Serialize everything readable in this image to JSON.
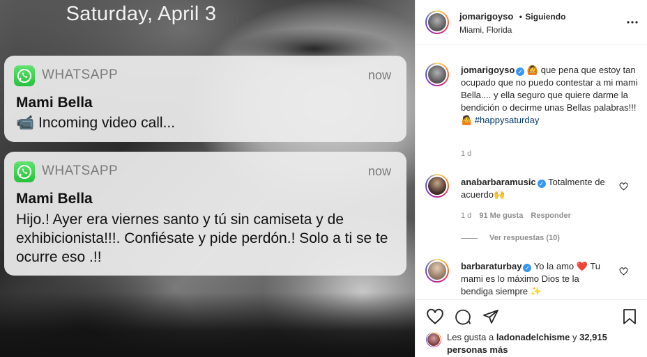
{
  "photo": {
    "date": "Saturday, April 3",
    "notifications": [
      {
        "app": "WHATSAPP",
        "time": "now",
        "sender": "Mami Bella",
        "body": "📹 Incoming video call..."
      },
      {
        "app": "WHATSAPP",
        "time": "now",
        "sender": "Mami Bella",
        "body": "Hijo.! Ayer era viernes santo y tú sin camiseta y de exhibicionista!!!. Confiésate y pide perdón.! Solo a ti se te ocurre eso .!!"
      }
    ]
  },
  "post": {
    "header": {
      "username": "jomarigoyso",
      "separator": "•",
      "follow_status": "Siguiendo",
      "location": "Miami, Florida",
      "more_icon": "more-horizontal-icon"
    },
    "caption": {
      "username": "jomarigoyso",
      "text_before_tag": "🙆 que pena que estoy tan ocupado que no puedo contestar a mi mami Bella.... y ella seguro que quiere darme la bendición o decirme unas Bellas palabras!!! 🤷",
      "hashtag": "#happysaturday",
      "age": "1 d"
    },
    "comments": [
      {
        "username": "anabarbaramusic",
        "text": "Totalmente de acuerdo🙌",
        "age": "1 d",
        "likes": "91 Me gusta",
        "reply_label": "Responder",
        "view_replies": "Ver respuestas (10)"
      },
      {
        "username": "barbaraturbay",
        "text": "Yo la amo ❤️ Tu mami es lo máximo Dios te la bendiga siempre ✨"
      }
    ],
    "likes": {
      "prefix": "Les gusta a",
      "user": "ladonadelchisme",
      "conjunction": "y",
      "count_text": "32,915 personas más"
    }
  },
  "colors": {
    "verified": "#3897f0",
    "whatsapp": "#25d366",
    "heart": "#ed4956",
    "link": "#00376b"
  }
}
